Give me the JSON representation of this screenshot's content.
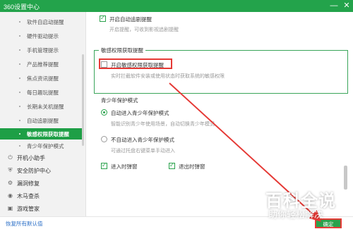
{
  "app": {
    "title": "360设置中心"
  },
  "window_controls": {
    "minimize": "—",
    "close": "✕"
  },
  "sidebar": {
    "sub_items": [
      {
        "label": "软件自启动提醒"
      },
      {
        "label": "硬件驱动提示"
      },
      {
        "label": "手机管理提示"
      },
      {
        "label": "产品推荐提醒"
      },
      {
        "label": "焦点资讯提醒"
      },
      {
        "label": "每日趣玩提醒"
      },
      {
        "label": "长期未关机提醒"
      },
      {
        "label": "自动追剧提醒"
      },
      {
        "label": "敏感权限获取提醒",
        "active": true
      },
      {
        "label": "青少年保护模式"
      }
    ],
    "groups": [
      {
        "label": "开机小助手",
        "icon": "power-icon"
      },
      {
        "label": "安全防护中心",
        "icon": "shield-icon"
      },
      {
        "label": "漏洞修复",
        "icon": "patch-icon"
      },
      {
        "label": "木马查杀",
        "icon": "trojan-scan-icon"
      },
      {
        "label": "游戏管家",
        "icon": "game-icon"
      }
    ]
  },
  "content": {
    "auto_follow": {
      "checkbox_label": "开启自动追剧提醒",
      "checked": true,
      "hint": "开启提醒，可收到影视追剧提醒"
    },
    "sensitive": {
      "group_title": "敏感权限获取提醒",
      "checkbox_label": "开启敏感权限获取提醒",
      "checked": false,
      "hint": "实时拦截软件安装或使用状态时获取系统的敏感权限"
    },
    "youth": {
      "section_title": "青少年保护模式",
      "option_auto": {
        "label": "自动进入青少年保护模式",
        "selected": true,
        "hint": "智能识别青少年使用场景，自动切换青少年模式"
      },
      "option_manual": {
        "label": "不自动进入青少年保护模式",
        "selected": false,
        "hint": "可通过托盘右键菜单手动进入"
      },
      "enter_popup": {
        "label": "进入时弹窗",
        "checked": true
      },
      "exit_popup": {
        "label": "退出时弹窗",
        "checked": true
      }
    }
  },
  "footer": {
    "reset_label": "恢复所有默认值",
    "ok_label": "确定"
  },
  "watermark": {
    "line1": "百科全说",
    "line2": "助你轻松解决"
  },
  "colors": {
    "brand_green": "#23a34b",
    "annotation_red": "#e53935",
    "link_blue": "#2b6fc7"
  }
}
